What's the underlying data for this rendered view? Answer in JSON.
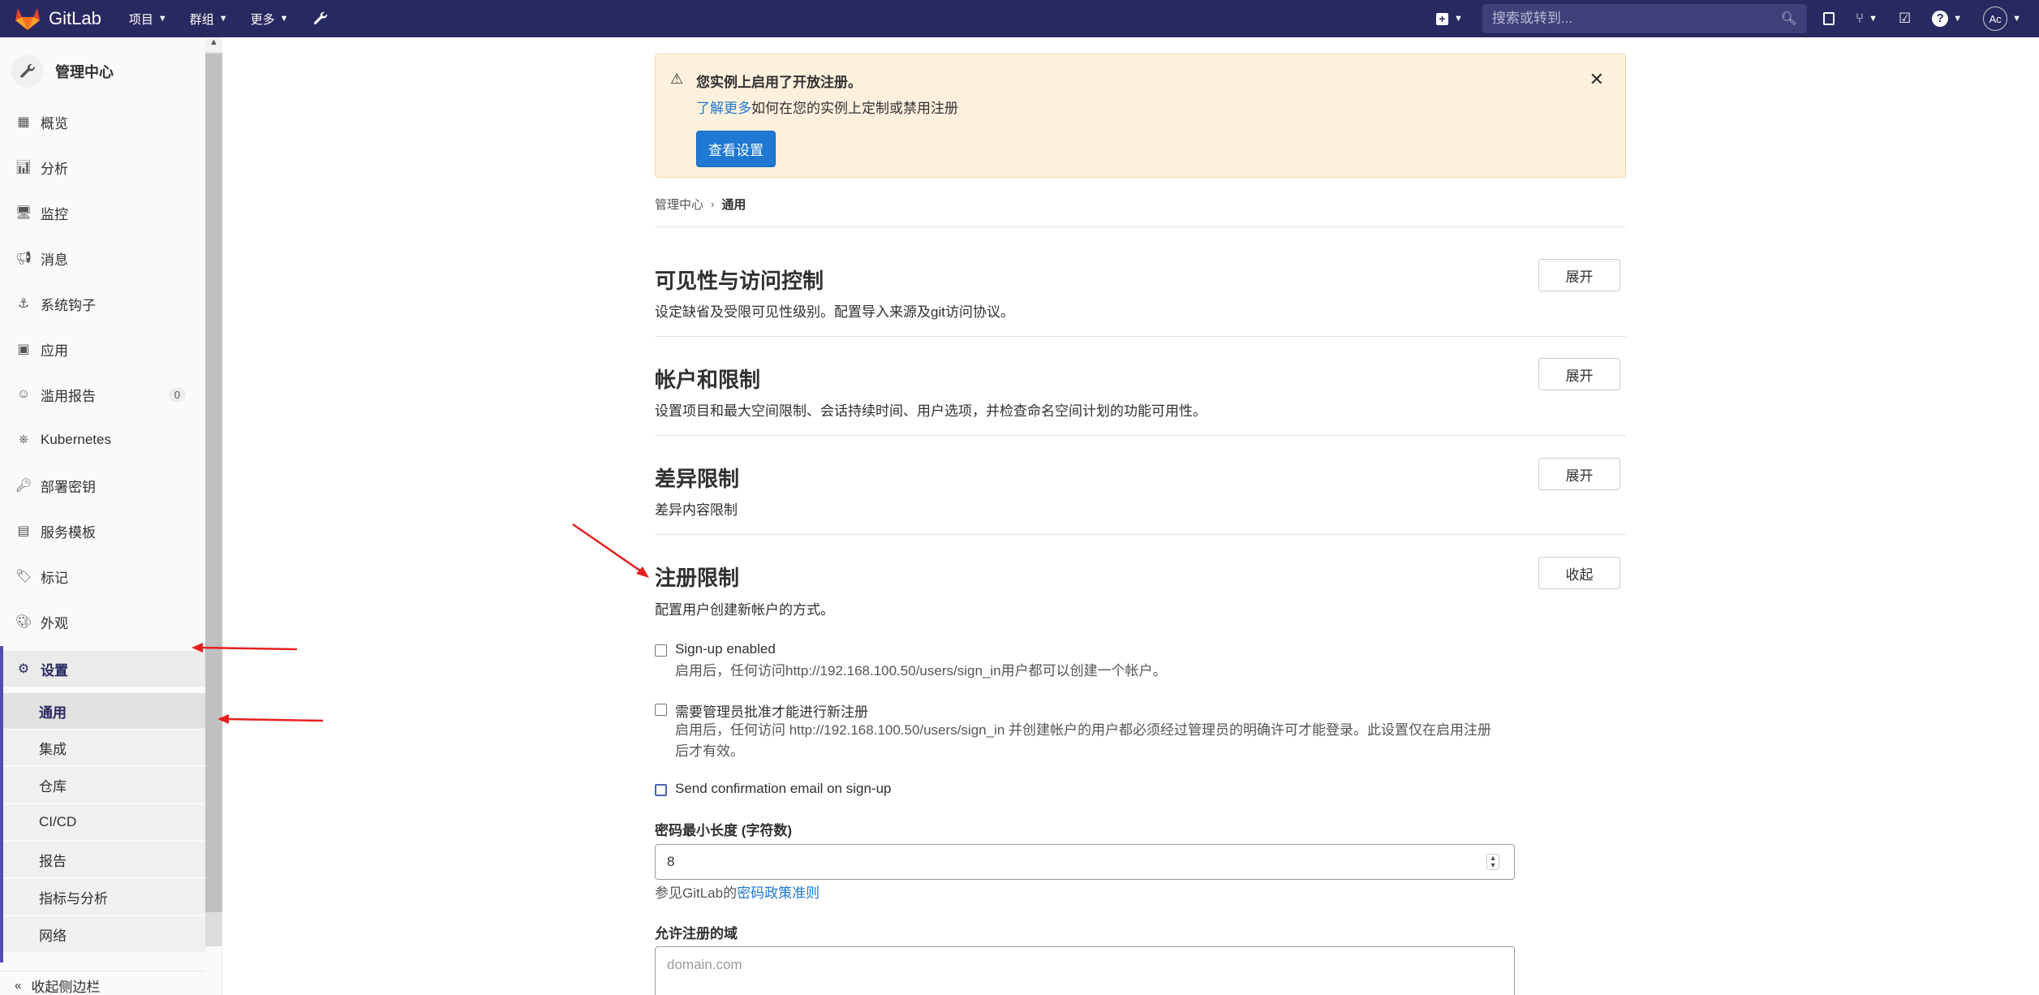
{
  "navbar": {
    "logo_text": "GitLab",
    "menu": [
      {
        "label": "项目"
      },
      {
        "label": "群组"
      },
      {
        "label": "更多"
      }
    ],
    "search_placeholder": "搜索或转到...",
    "avatar_text": "Ac"
  },
  "sidebar": {
    "header": "管理中心",
    "items": [
      {
        "label": "概览",
        "icon": "overview-icon"
      },
      {
        "label": "分析",
        "icon": "analytics-icon"
      },
      {
        "label": "监控",
        "icon": "monitor-icon"
      },
      {
        "label": "消息",
        "icon": "megaphone-icon"
      },
      {
        "label": "系统钩子",
        "icon": "hook-icon"
      },
      {
        "label": "应用",
        "icon": "apps-icon"
      },
      {
        "label": "滥用报告",
        "icon": "smiley-icon",
        "badge": "0"
      },
      {
        "label": "Kubernetes",
        "icon": "kubernetes-icon"
      },
      {
        "label": "部署密钥",
        "icon": "key-icon"
      },
      {
        "label": "服务模板",
        "icon": "template-icon"
      },
      {
        "label": "标记",
        "icon": "tag-icon"
      },
      {
        "label": "外观",
        "icon": "palette-icon"
      },
      {
        "label": "设置",
        "icon": "gear-icon"
      }
    ],
    "subitems": [
      {
        "label": "通用"
      },
      {
        "label": "集成"
      },
      {
        "label": "仓库"
      },
      {
        "label": "CI/CD"
      },
      {
        "label": "报告"
      },
      {
        "label": "指标与分析"
      },
      {
        "label": "网络"
      }
    ],
    "collapse_label": "收起侧边栏"
  },
  "alert": {
    "title": "您实例上启用了开放注册。",
    "link": "了解更多",
    "body": "如何在您的实例上定制或禁用注册",
    "button": "查看设置"
  },
  "breadcrumb": {
    "parent": "管理中心",
    "current": "通用"
  },
  "sections": [
    {
      "title": "可见性与访问控制",
      "desc": "设定缺省及受限可见性级别。配置导入来源及git访问协议。",
      "button": "展开"
    },
    {
      "title": "帐户和限制",
      "desc": "设置项目和最大空间限制、会话持续时间、用户选项，并检查命名空间计划的功能可用性。",
      "button": "展开"
    },
    {
      "title": "差异限制",
      "desc": "差异内容限制",
      "button": "展开"
    },
    {
      "title": "注册限制",
      "desc": "配置用户创建新帐户的方式。",
      "button": "收起"
    }
  ],
  "signup": {
    "enabled_label": "Sign-up enabled",
    "enabled_help": "启用后，任何访问http://192.168.100.50/users/sign_in用户都可以创建一个帐户。",
    "approval_label": "需要管理员批准才能进行新注册",
    "approval_help_1": "启用后，任何访问 http://192.168.100.50/users/sign_in 并创建帐户的用户都必须经过管理员的明确许可才能登录。此设置仅在启用注册",
    "approval_help_2": "后才有效。",
    "confirm_label": "Send confirmation email on sign-up",
    "min_length_label": "密码最小长度 (字符数)",
    "min_length_value": "8",
    "policy_help_prefix": "参见GitLab的",
    "policy_help_link": "密码政策准则",
    "domains_label": "允许注册的域",
    "domains_placeholder": "domain.com"
  }
}
